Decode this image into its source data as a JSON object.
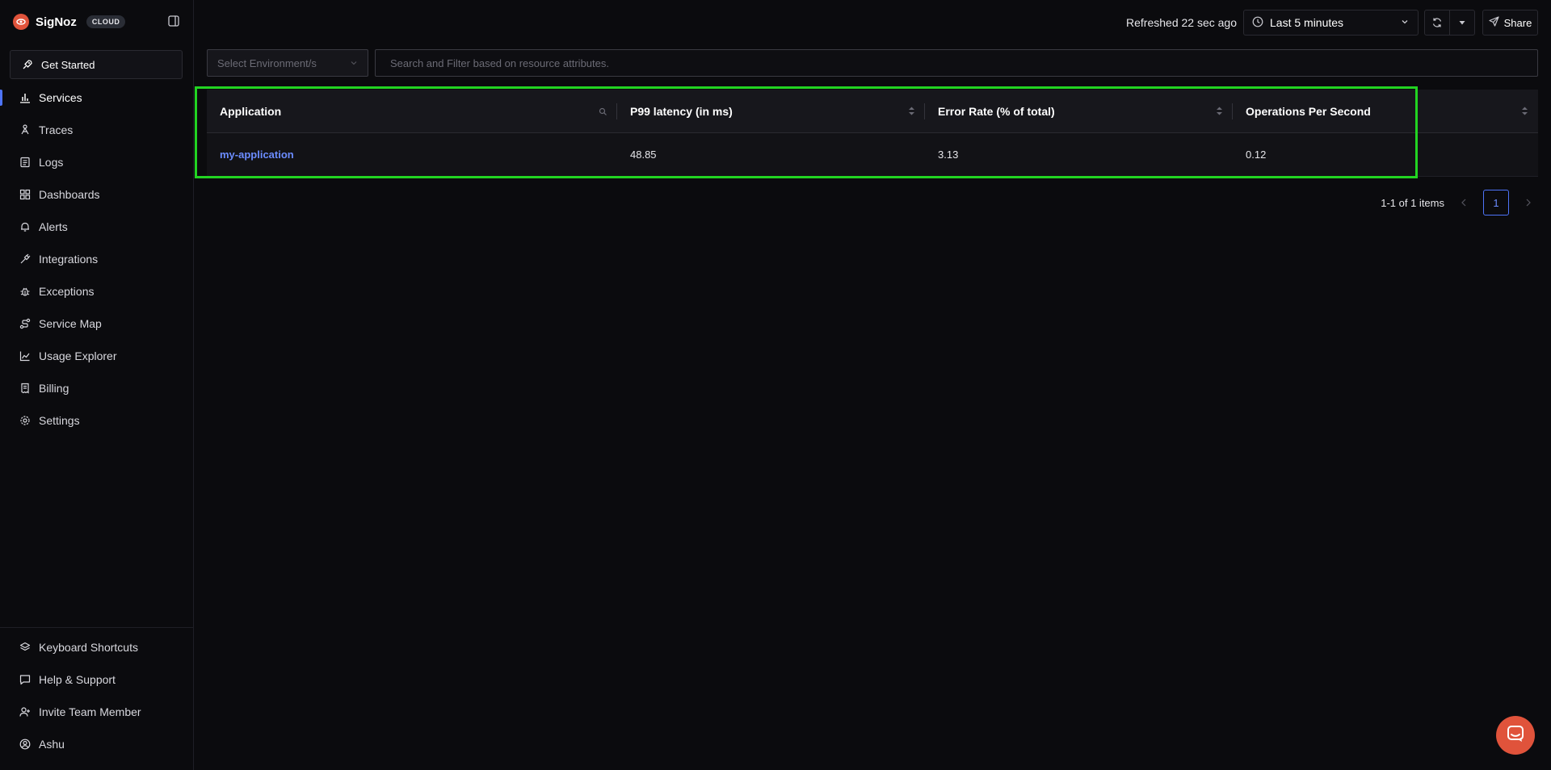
{
  "brand": {
    "name": "SigNoz",
    "badge": "CLOUD",
    "accent": "#e0533b"
  },
  "sidebar": {
    "get_started": "Get Started",
    "items": [
      {
        "label": "Services",
        "icon": "bar-chart-icon",
        "active": true
      },
      {
        "label": "Traces",
        "icon": "traces-icon"
      },
      {
        "label": "Logs",
        "icon": "logs-icon"
      },
      {
        "label": "Dashboards",
        "icon": "dashboards-icon"
      },
      {
        "label": "Alerts",
        "icon": "bell-icon"
      },
      {
        "label": "Integrations",
        "icon": "plug-icon"
      },
      {
        "label": "Exceptions",
        "icon": "bug-icon"
      },
      {
        "label": "Service Map",
        "icon": "route-icon"
      },
      {
        "label": "Usage Explorer",
        "icon": "line-chart-icon"
      },
      {
        "label": "Billing",
        "icon": "receipt-icon"
      },
      {
        "label": "Settings",
        "icon": "gear-icon"
      }
    ],
    "bottom": [
      {
        "label": "Keyboard Shortcuts",
        "icon": "layers-icon"
      },
      {
        "label": "Help & Support",
        "icon": "message-icon"
      },
      {
        "label": "Invite Team Member",
        "icon": "user-plus-icon"
      },
      {
        "label": "Ashu",
        "icon": "user-circle-icon"
      }
    ]
  },
  "topbar": {
    "refreshed": "Refreshed 22 sec ago",
    "time_range": "Last 5 minutes",
    "share": "Share"
  },
  "filters": {
    "environment_placeholder": "Select Environment/s",
    "search_placeholder": "Search and Filter based on resource attributes."
  },
  "table": {
    "columns": [
      "Application",
      "P99 latency (in ms)",
      "Error Rate (% of total)",
      "Operations Per Second"
    ],
    "rows": [
      {
        "application": "my-application",
        "p99": "48.85",
        "error_rate": "3.13",
        "ops": "0.12"
      }
    ]
  },
  "pagination": {
    "summary": "1-1 of 1 items",
    "current_page": "1"
  },
  "colors": {
    "highlight": "#22d422",
    "link": "#6b8cff",
    "active_indicator": "#4e74f8"
  }
}
